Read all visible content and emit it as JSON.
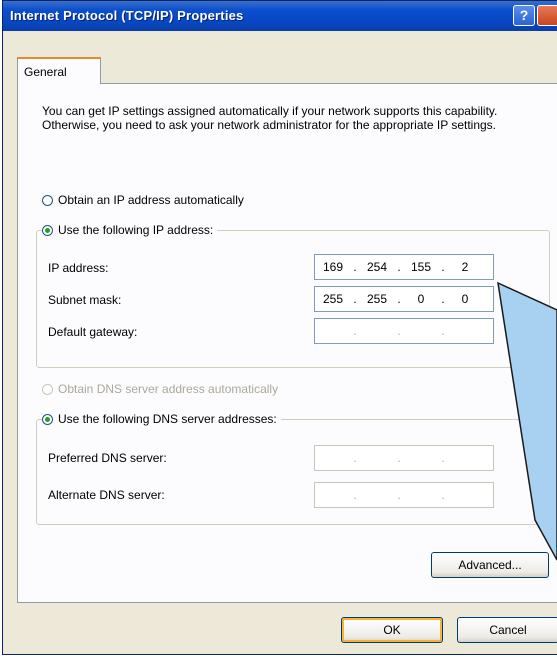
{
  "window": {
    "title": "Internet Protocol (TCP/IP) Properties",
    "help_label": "?",
    "help_icon": "question-icon",
    "close_icon": "close-icon"
  },
  "tabs": [
    {
      "label": "General",
      "selected": true
    }
  ],
  "intro_text": "You can get IP settings assigned automatically if your network supports this capability. Otherwise, you need to ask your network administrator for the appropriate IP settings.",
  "ip_section": {
    "auto_label": "Obtain an IP address automatically",
    "manual_label": "Use the following IP address:",
    "selected": "manual",
    "fields": [
      {
        "label": "IP address:",
        "octets": [
          "169",
          "254",
          "155",
          "2"
        ]
      },
      {
        "label": "Subnet mask:",
        "octets": [
          "255",
          "255",
          "0",
          "0"
        ]
      },
      {
        "label": "Default gateway:",
        "octets": [
          "",
          "",
          "",
          ""
        ]
      }
    ]
  },
  "dns_section": {
    "auto_label": "Obtain DNS server address automatically",
    "auto_enabled": false,
    "manual_label": "Use the following DNS server addresses:",
    "selected": "manual",
    "fields": [
      {
        "label": "Preferred DNS server:",
        "octets": [
          "",
          "",
          "",
          ""
        ]
      },
      {
        "label": "Alternate DNS server:",
        "octets": [
          "",
          "",
          "",
          ""
        ]
      }
    ]
  },
  "buttons": {
    "advanced": "Advanced...",
    "ok": "OK",
    "cancel": "Cancel"
  },
  "colors": {
    "titlebar": "#0a4fcf",
    "radio_selected": "#21a121",
    "annotation_fill": "#a8d0f0"
  }
}
